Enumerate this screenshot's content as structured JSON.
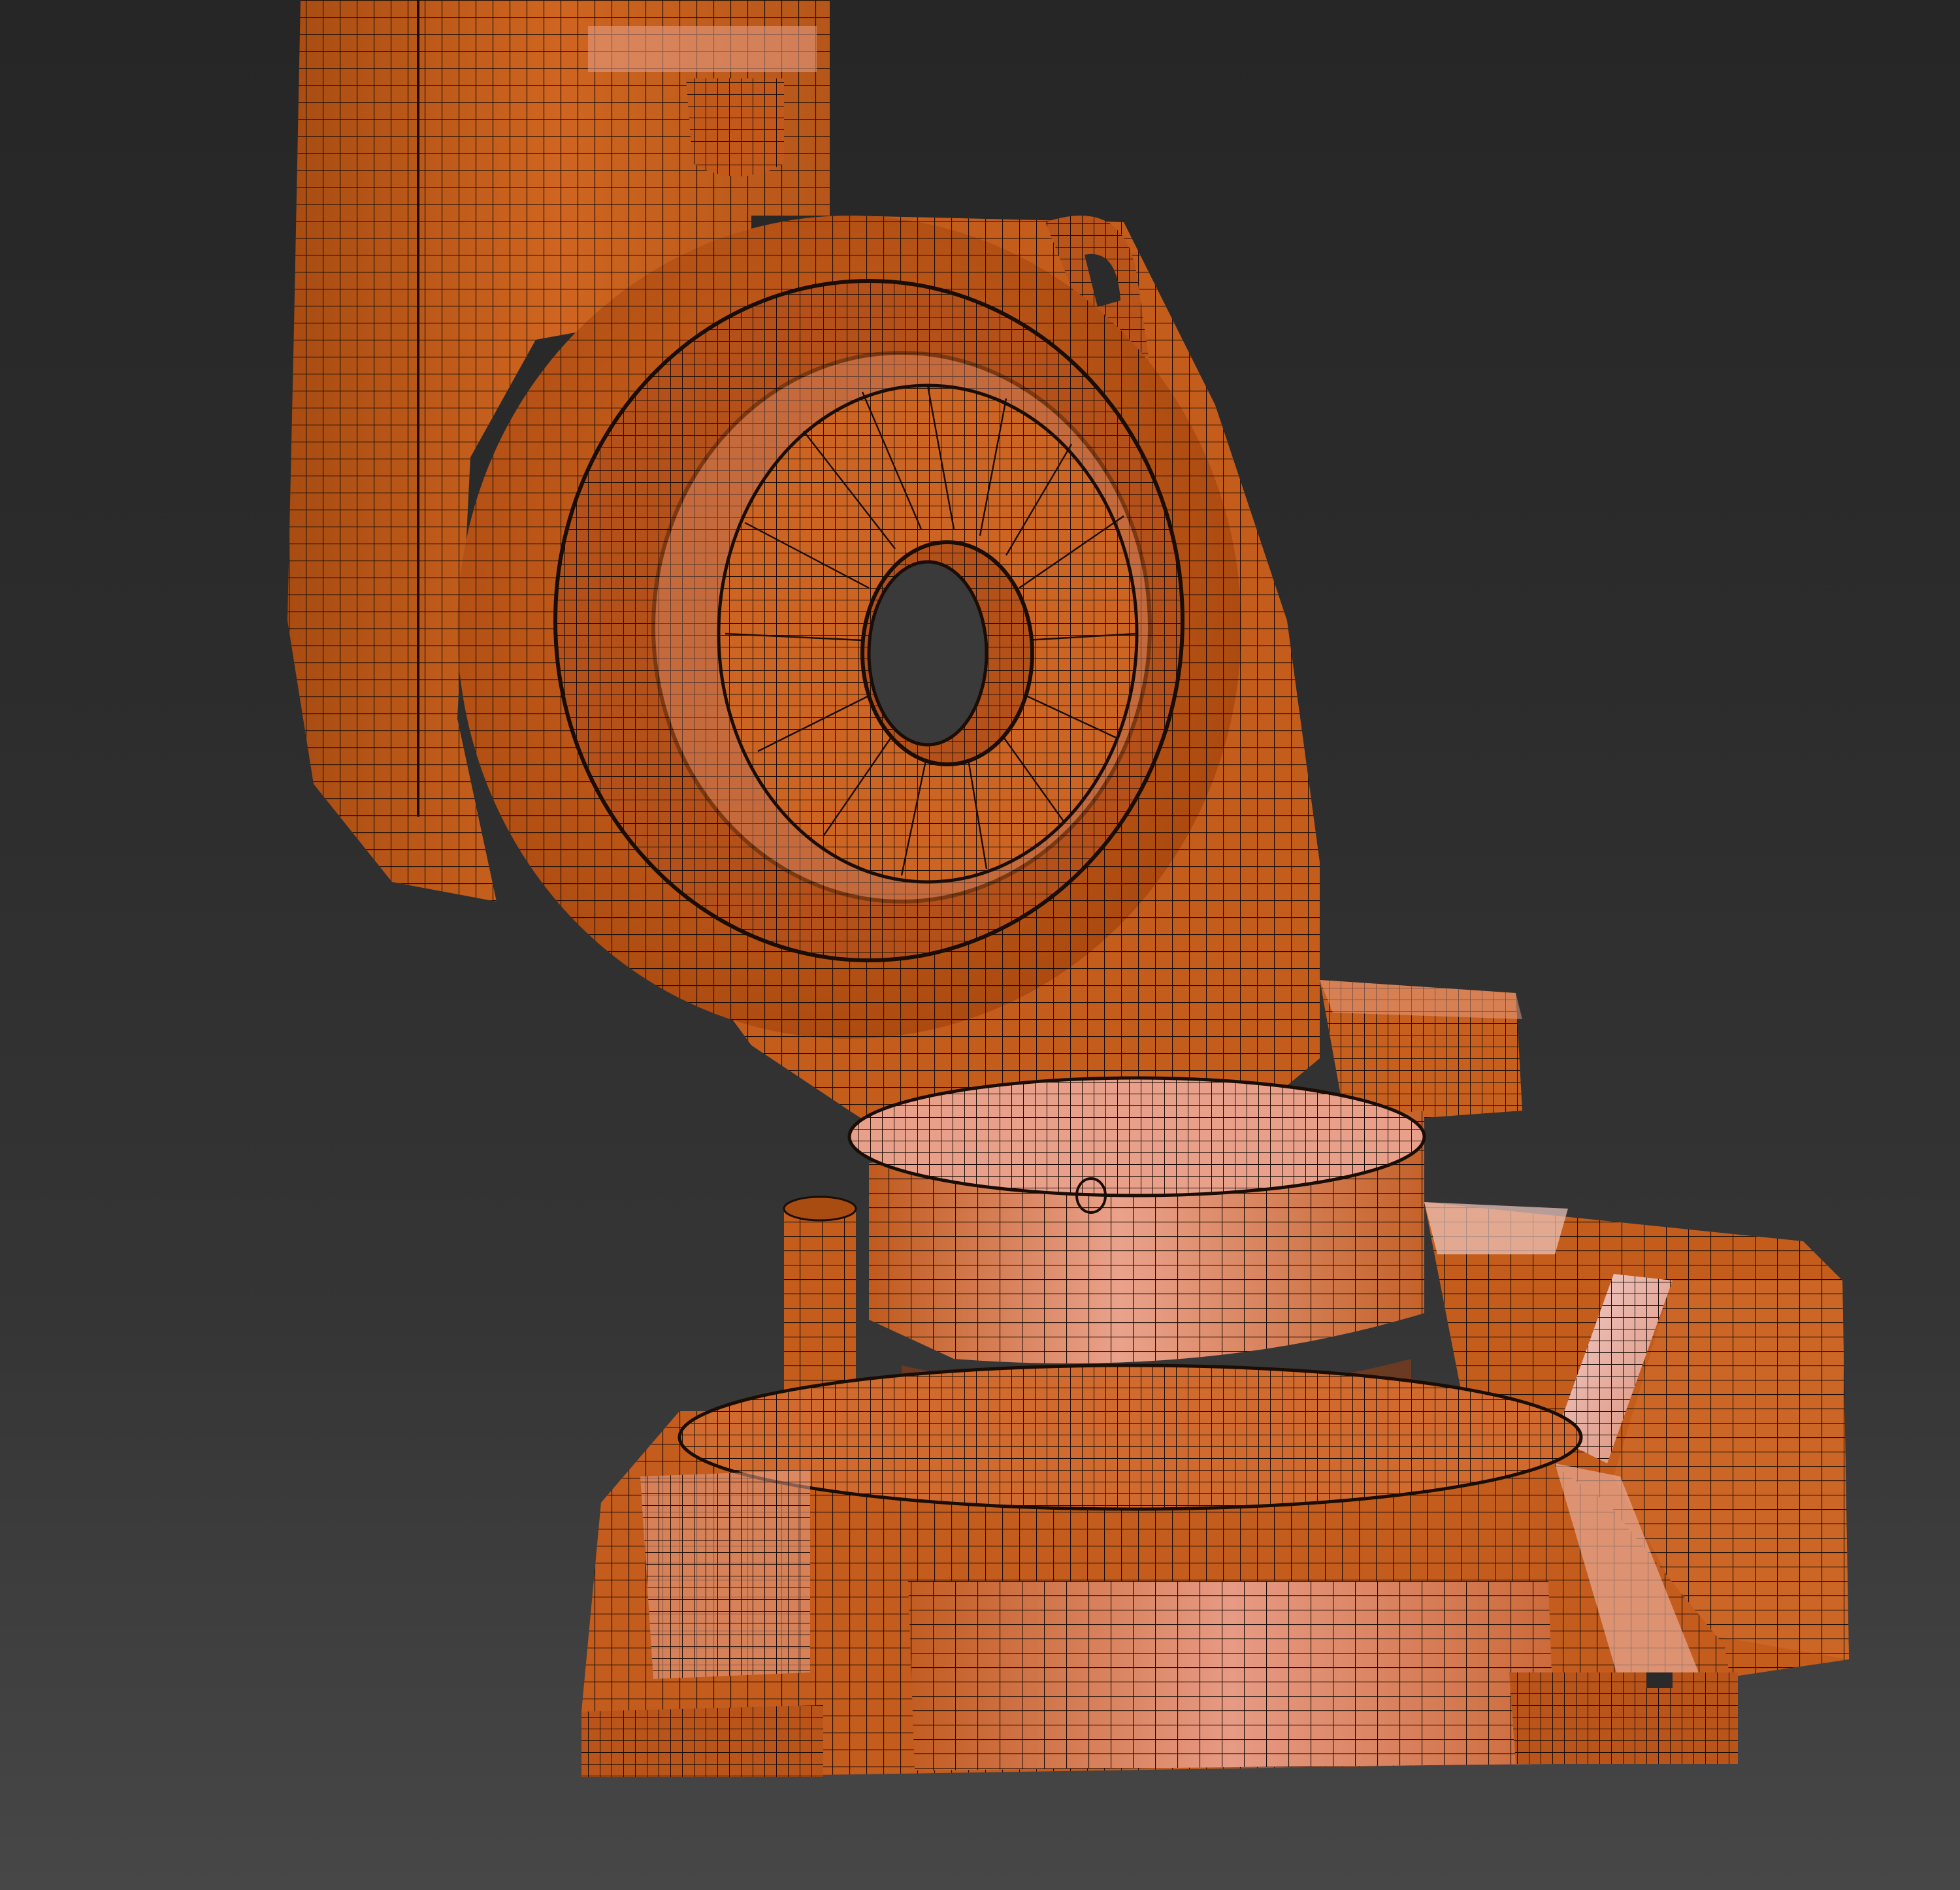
{
  "viewport": {
    "background_top": "#262626",
    "background_bottom": "#474747",
    "display_mode": "shaded-with-edged-faces"
  },
  "model": {
    "subject": "industrial-robot-arm-base",
    "base_color": "#c9611f",
    "highlight_color": "#e8a08a",
    "edge_color": "#1a0d05",
    "parts": [
      "upper-arm",
      "shoulder-hub",
      "motor-housing",
      "turntable",
      "pedestal-base",
      "cable-pillar",
      "side-cabinet"
    ]
  }
}
